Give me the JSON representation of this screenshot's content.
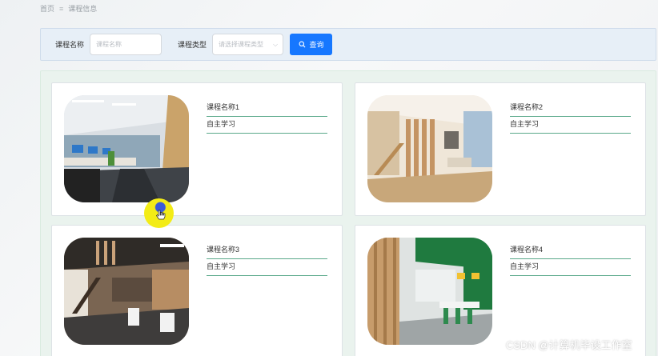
{
  "breadcrumb": {
    "home": "首页",
    "separator": "≡",
    "current": "课程信息"
  },
  "search": {
    "name_label": "课程名称",
    "name_placeholder": "课程名称",
    "type_label": "课程类型",
    "type_placeholder": "请选择课程类型",
    "button_label": "查询"
  },
  "courses": [
    {
      "name": "课程名称1",
      "type": "自主学习",
      "image": "open-office-photo"
    },
    {
      "name": "课程名称2",
      "type": "自主学习",
      "image": "loft-interior-photo"
    },
    {
      "name": "课程名称3",
      "type": "自主学习",
      "image": "office-lounge-photo"
    },
    {
      "name": "课程名称4",
      "type": "自主学习",
      "image": "green-office-photo"
    }
  ],
  "watermark": "CSDN @计算机毕设工作室",
  "colors": {
    "accent": "#1677ff",
    "underline": "#5aa98a",
    "cursor_highlight": "#f3ec16"
  }
}
